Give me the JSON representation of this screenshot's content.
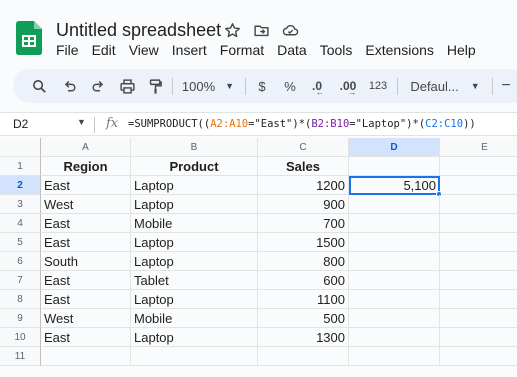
{
  "app": {
    "doc_title": "Untitled spreadsheet",
    "menu": [
      "File",
      "Edit",
      "View",
      "Insert",
      "Format",
      "Data",
      "Tools",
      "Extensions",
      "Help"
    ],
    "accent_color": "#1a73e8",
    "brand_color": "#0f9d58"
  },
  "toolbar": {
    "zoom": "100%",
    "currency": "$",
    "percent": "%",
    "decrease_decimal": ".0",
    "increase_decimal": ".00",
    "number_format": "123",
    "font": "Defaul..."
  },
  "formula_bar": {
    "cell_ref": "D2",
    "fx": "fx",
    "formula_parts": [
      {
        "text": "=SUMPRODUCT((",
        "color": "#1f1f1f"
      },
      {
        "text": "A2:A10",
        "color": "#e8710a"
      },
      {
        "text": "=\"East\")*(",
        "color": "#1f1f1f"
      },
      {
        "text": "B2:B10",
        "color": "#7b1fa2"
      },
      {
        "text": "=\"Laptop\")*(",
        "color": "#1f1f1f"
      },
      {
        "text": "C2:C10",
        "color": "#1a73e8"
      },
      {
        "text": "))",
        "color": "#1f1f1f"
      }
    ]
  },
  "sheet": {
    "columns": [
      "A",
      "B",
      "C",
      "D",
      "E"
    ],
    "selected_column": "D",
    "selected_row": 2,
    "rows": [
      {
        "num": "1",
        "a": "Region",
        "b": "Product",
        "c": "Sales",
        "d": "",
        "e": ""
      },
      {
        "num": "2",
        "a": "East",
        "b": "Laptop",
        "c": "1200",
        "d": "5,100",
        "e": ""
      },
      {
        "num": "3",
        "a": "West",
        "b": "Laptop",
        "c": "900",
        "d": "",
        "e": ""
      },
      {
        "num": "4",
        "a": "East",
        "b": "Mobile",
        "c": "700",
        "d": "",
        "e": ""
      },
      {
        "num": "5",
        "a": "East",
        "b": "Laptop",
        "c": "1500",
        "d": "",
        "e": ""
      },
      {
        "num": "6",
        "a": "South",
        "b": "Laptop",
        "c": "800",
        "d": "",
        "e": ""
      },
      {
        "num": "7",
        "a": "East",
        "b": "Tablet",
        "c": "600",
        "d": "",
        "e": ""
      },
      {
        "num": "8",
        "a": "East",
        "b": "Laptop",
        "c": "1100",
        "d": "",
        "e": ""
      },
      {
        "num": "9",
        "a": "West",
        "b": "Mobile",
        "c": "500",
        "d": "",
        "e": ""
      },
      {
        "num": "10",
        "a": "East",
        "b": "Laptop",
        "c": "1300",
        "d": "",
        "e": ""
      },
      {
        "num": "11",
        "a": "",
        "b": "",
        "c": "",
        "d": "",
        "e": ""
      }
    ]
  }
}
